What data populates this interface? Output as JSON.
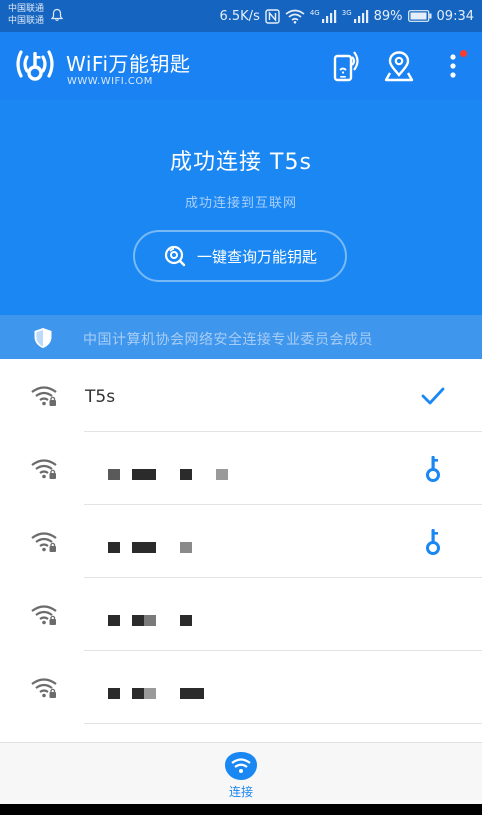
{
  "status_bar": {
    "carrier_1": "中国联通",
    "carrier_2": "中国联通",
    "speed": "6.5K/s",
    "net_4g": "4G",
    "net_3g": "3G",
    "battery": "89%",
    "time": "09:34"
  },
  "app_bar": {
    "title": "WiFi万能钥匙",
    "subtitle": "WWW.WIFI.COM",
    "icons": [
      "wifi-key-logo-icon",
      "phone-signal-icon",
      "map-pin-icon",
      "more-vertical-icon"
    ]
  },
  "hero": {
    "title": "成功连接 T5s",
    "subtitle": "成功连接到互联网",
    "query_button": "一键查询万能钥匙"
  },
  "security": {
    "text": "中国计算机协会网络安全连接专业委员会成员"
  },
  "networks": [
    {
      "ssid": "T5s",
      "status": "connected"
    },
    {
      "ssid": "",
      "status": "key"
    },
    {
      "ssid": "",
      "status": "key"
    },
    {
      "ssid": "",
      "status": "none"
    },
    {
      "ssid": "",
      "status": "none"
    }
  ],
  "bottom_nav": {
    "connect_label": "连接"
  },
  "colors": {
    "status_bar": "#1565c0",
    "app_bar": "#1a82f2",
    "hero": "#1a87f3",
    "security_strip": "#3f96ed",
    "accent": "#1a87f3",
    "badge": "#ff3b30"
  }
}
